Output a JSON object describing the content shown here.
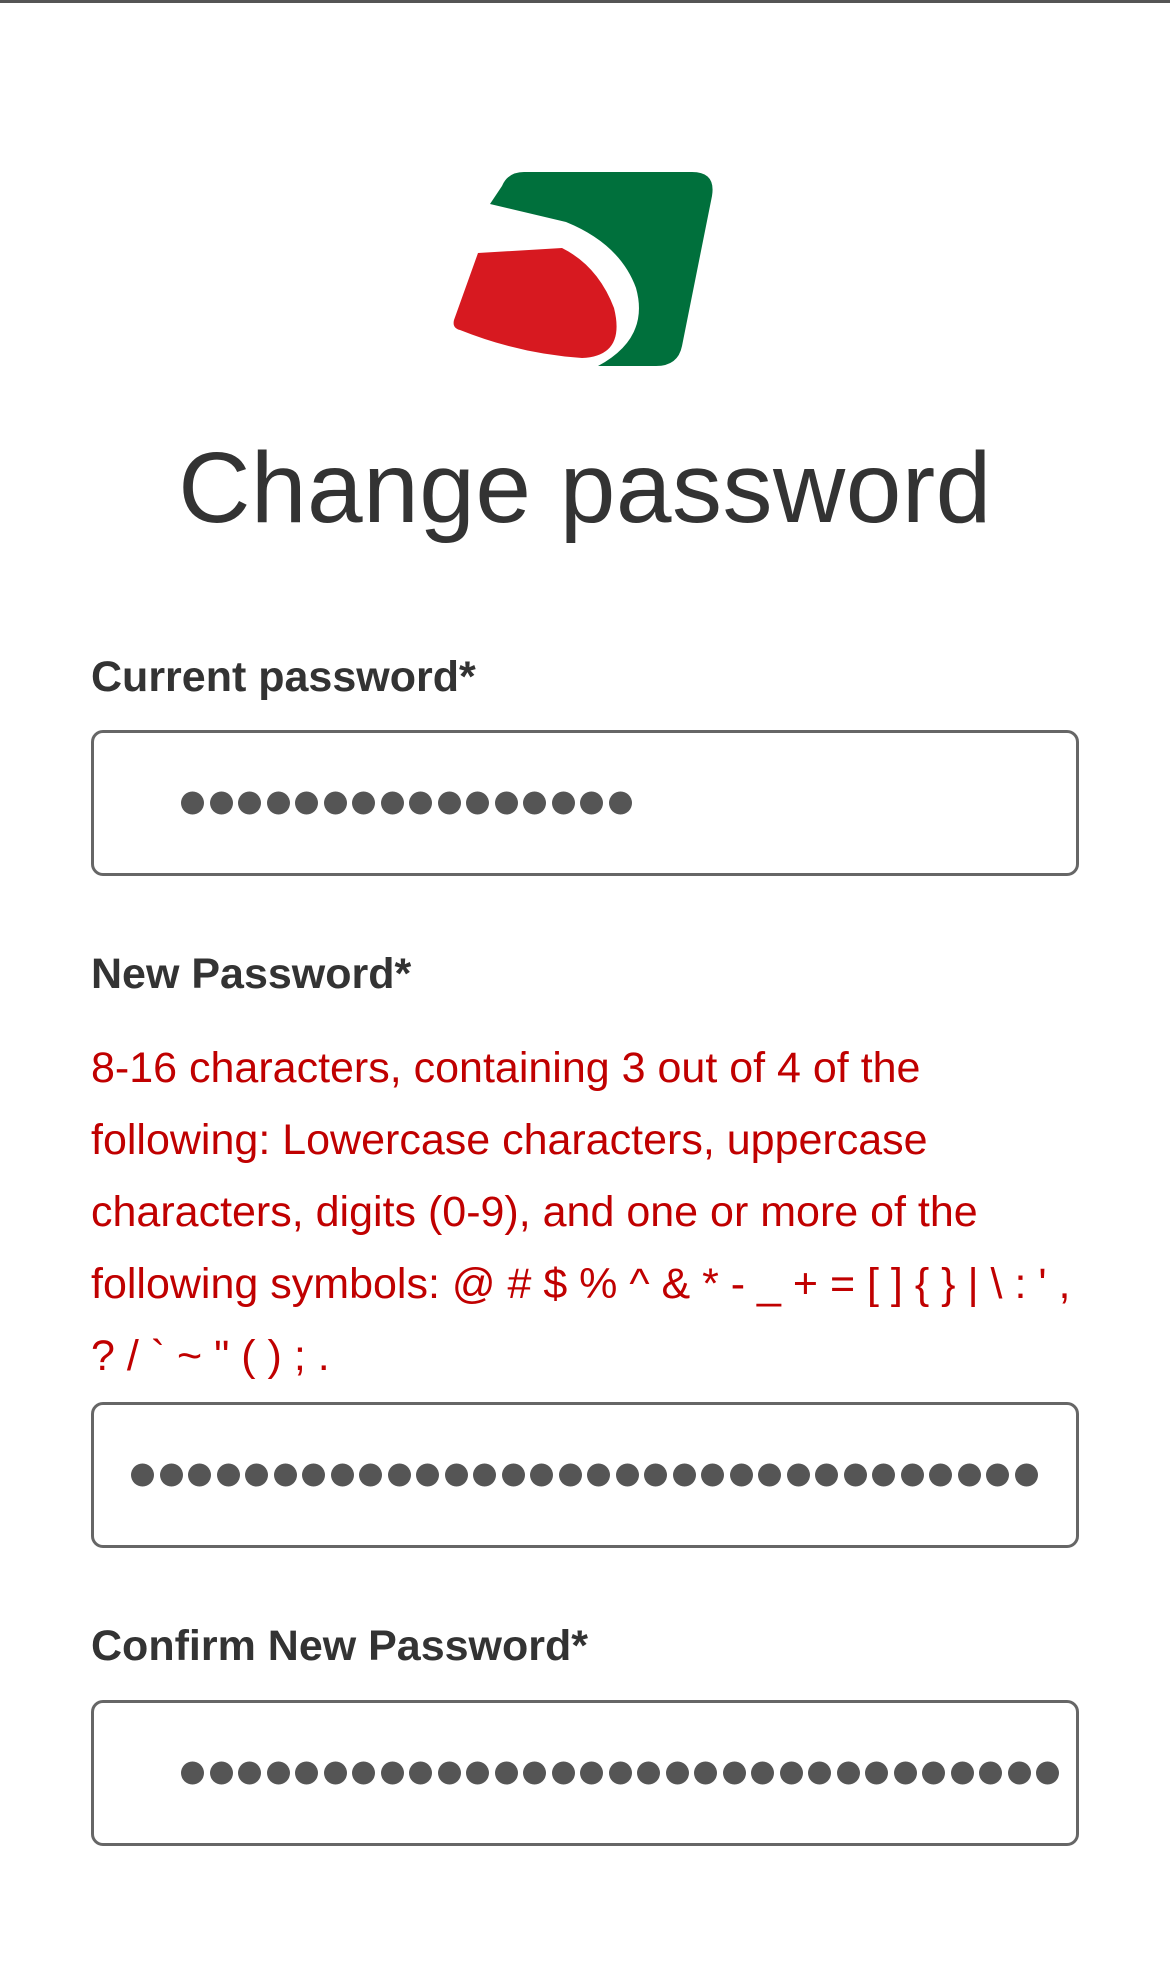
{
  "brand": {
    "logo_name": "brand-logo",
    "colors": {
      "green": "#00703c",
      "red": "#d71920"
    }
  },
  "page": {
    "title": "Change password"
  },
  "form": {
    "current_password": {
      "label": "Current password*",
      "masked_length": 16
    },
    "new_password": {
      "label": "New Password*",
      "hint_lines": [
        "8-16 characters, containing 3 out of 4 of the",
        "following: Lowercase characters, uppercase",
        "characters, digits (0-9), and one or more of the",
        "following symbols: @ # $ % ^ & * - _ + = [ ] { } | \\ : ' ,",
        "? / ` ~ \" ( ) ; ."
      ],
      "masked_length": 32
    },
    "confirm_password": {
      "label": "Confirm New Password*",
      "masked_length": 31
    }
  },
  "colors": {
    "text": "#333333",
    "hint": "#c00000",
    "border": "#666666",
    "dot": "#555555"
  }
}
